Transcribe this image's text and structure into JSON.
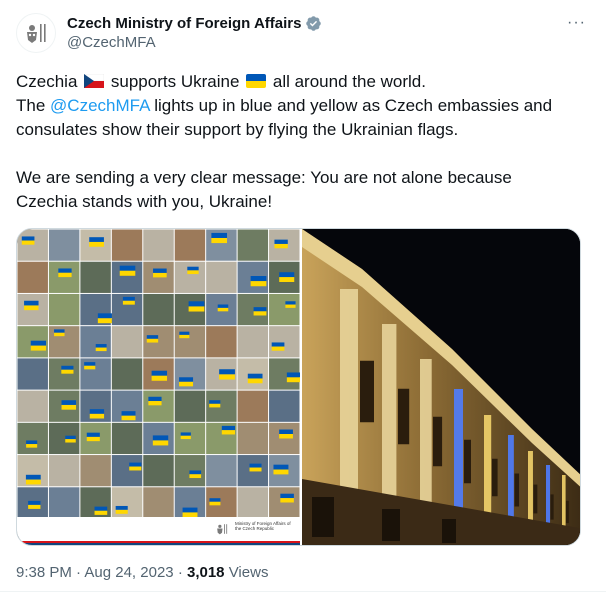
{
  "author": {
    "display_name": "Czech Ministry of Foreign Affairs",
    "handle": "@CzechMFA",
    "verified": "verified-badge-icon",
    "avatar": "czech-mfa-logo-icon"
  },
  "more_menu": "···",
  "tweet": {
    "line1_a": "Czechia",
    "line1_flag": "czech-flag-icon",
    "line1_b": "supports Ukraine",
    "line1_flag2": "ukraine-flag-icon",
    "line1_c": "all around the world.",
    "line2_a": "The",
    "line2_mention": "@CzechMFA",
    "line2_b": "lights up in blue and yellow as Czech embassies and consulates show their support by flying the Ukrainian flags.",
    "paragraph2": "We are sending a very clear message: You are not alone because Czechia stands with you, Ukraine!"
  },
  "media": {
    "left_image": "collage-of-embassies-with-ukrainian-flags",
    "left_caption": "Ministry of Foreign Affairs of the Czech Republic",
    "right_image": "ministry-building-lit-in-blue-and-yellow-at-night"
  },
  "meta": {
    "time": "9:38 PM",
    "separator": "·",
    "date": "Aug 24, 2023",
    "views_count": "3,018",
    "views_label": "Views"
  },
  "colors": {
    "ukraine_blue": "#0057b7",
    "ukraine_yellow": "#ffd700",
    "link": "#1d9bf0",
    "secondary_text": "#536471"
  }
}
